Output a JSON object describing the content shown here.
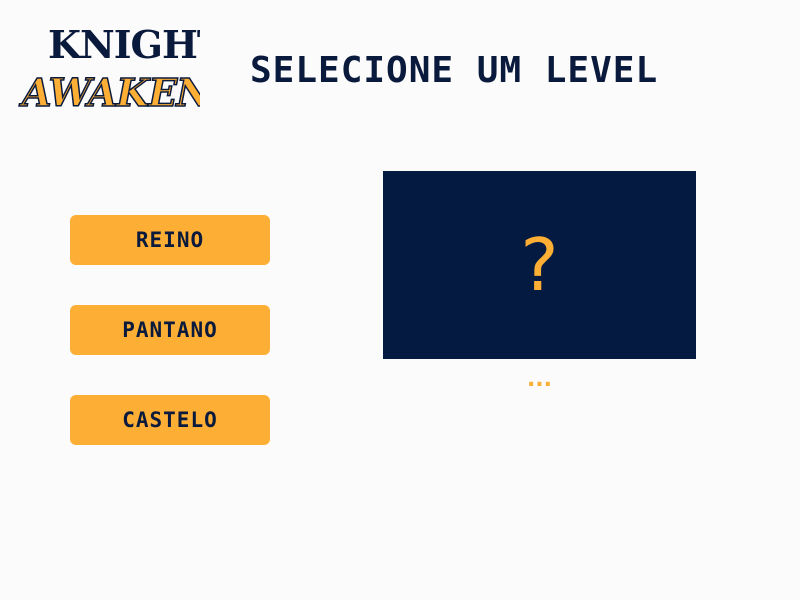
{
  "logo": {
    "line1": "KNIGHT",
    "line2": "AWAKENS",
    "colors": {
      "line1": "#0a1a3c",
      "line2": "#fdae34",
      "outline": "#0a1a3c"
    }
  },
  "header": {
    "title": "SELECIONE UM LEVEL"
  },
  "levels": [
    {
      "label": "REINO"
    },
    {
      "label": "PANTANO"
    },
    {
      "label": "CASTELO"
    }
  ],
  "preview": {
    "symbol": "?",
    "caption": "..."
  },
  "colors": {
    "background": "#fbfbfb",
    "accent": "#fdae34",
    "navy": "#041a40",
    "text": "#0a1a3c"
  }
}
